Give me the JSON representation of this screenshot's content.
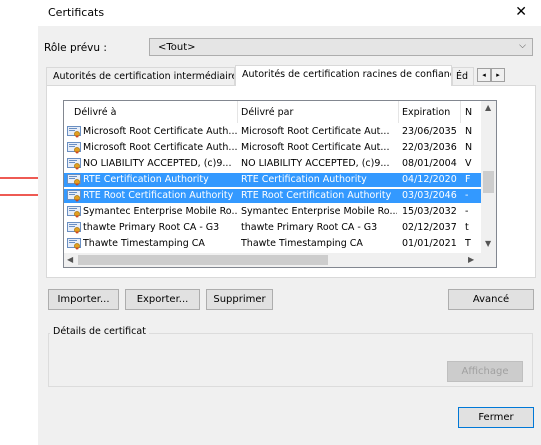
{
  "window": {
    "title": "Certificats",
    "close_glyph": "✕"
  },
  "role": {
    "label": "Rôle prévu :",
    "value": "<Tout>",
    "arrow": "⌵"
  },
  "tabs": [
    {
      "label": "Autorités de certification intermédiaires"
    },
    {
      "label": "Autorités de certification racines de confiance"
    },
    {
      "label": "Éd"
    }
  ],
  "tab_scroll": {
    "left": "◂",
    "right": "▸"
  },
  "columns": {
    "issued_to": "Délivré à",
    "issued_by": "Délivré par",
    "expiration": "Expiration",
    "extra": "N"
  },
  "rows": [
    {
      "to": "Microsoft Root Certificate Auth...",
      "by": "Microsoft Root Certificate Aut...",
      "exp": "23/06/2035",
      "extra": "N",
      "selected": false
    },
    {
      "to": "Microsoft Root Certificate Auth...",
      "by": "Microsoft Root Certificate Aut...",
      "exp": "22/03/2036",
      "extra": "N",
      "selected": false
    },
    {
      "to": "NO LIABILITY ACCEPTED, (c)9...",
      "by": "NO LIABILITY ACCEPTED, (c)9...",
      "exp": "08/01/2004",
      "extra": "V",
      "selected": false
    },
    {
      "to": "RTE Certification Authority",
      "by": "RTE Certification Authority",
      "exp": "04/12/2020",
      "extra": "F",
      "selected": true
    },
    {
      "to": "RTE Root Certification Authority",
      "by": "RTE Root Certification Authority",
      "exp": "03/03/2046",
      "extra": "-",
      "selected": true
    },
    {
      "to": "Symantec Enterprise Mobile Ro...",
      "by": "Symantec Enterprise Mobile Ro...",
      "exp": "15/03/2032",
      "extra": "-",
      "selected": false
    },
    {
      "to": "thawte Primary Root CA - G3",
      "by": "thawte Primary Root CA - G3",
      "exp": "02/12/2037",
      "extra": "t",
      "selected": false
    },
    {
      "to": "Thawte Timestamping CA",
      "by": "Thawte Timestamping CA",
      "exp": "01/01/2021",
      "extra": "T",
      "selected": false
    }
  ],
  "buttons": {
    "import": "Importer...",
    "export": "Exporter...",
    "remove": "Supprimer",
    "advanced": "Avancé",
    "view": "Affichage",
    "close": "Fermer"
  },
  "details": {
    "label": "Détails de certificat"
  },
  "colors": {
    "selection": "#3399ff",
    "annotation": "#e8231a"
  }
}
